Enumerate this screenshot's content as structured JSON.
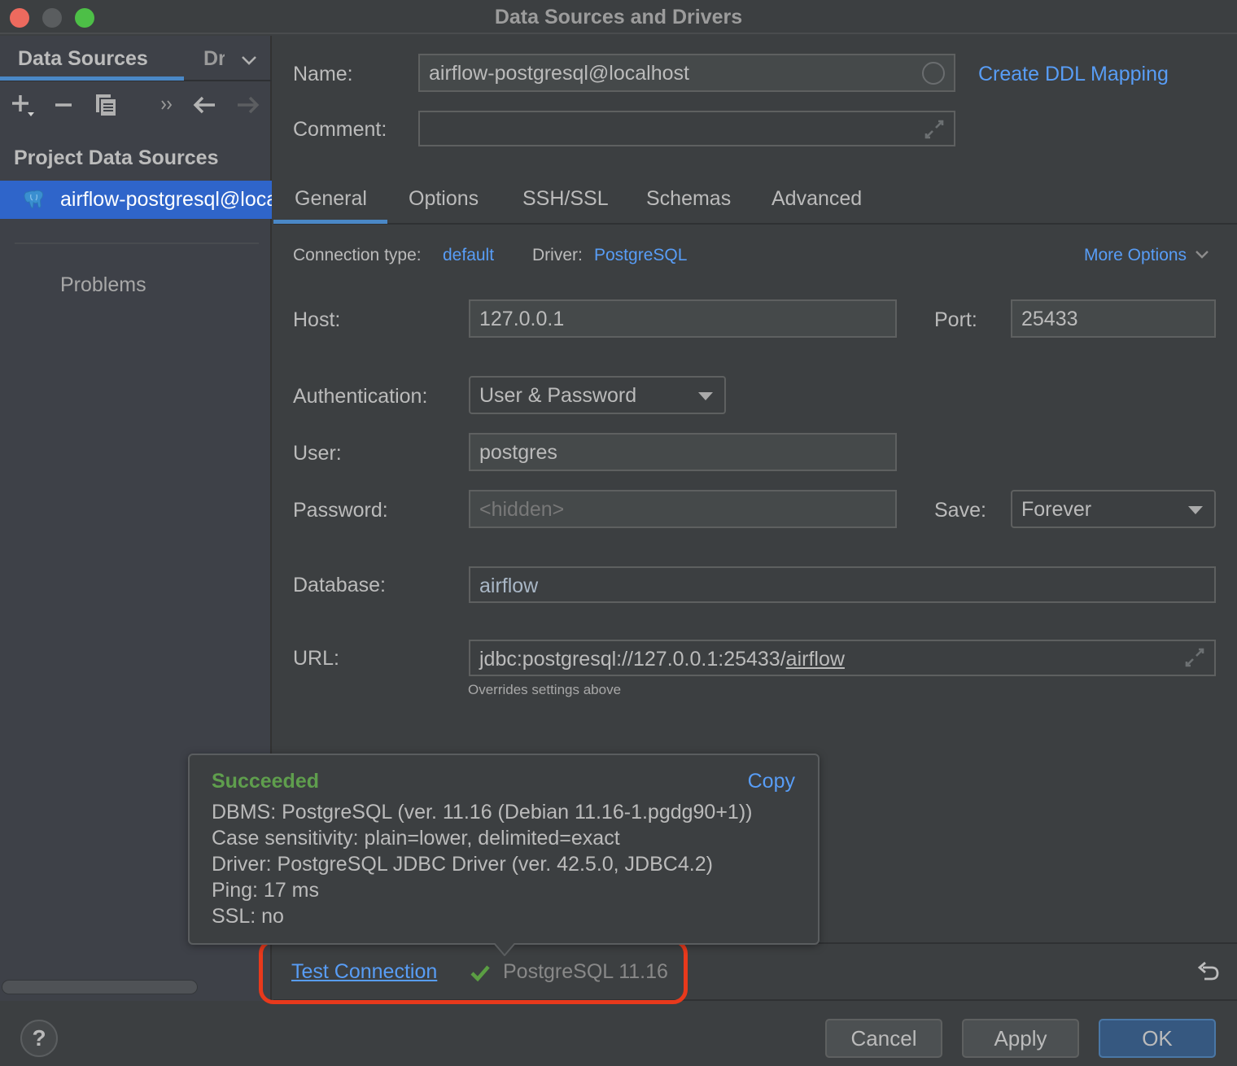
{
  "window": {
    "title": "Data Sources and Drivers"
  },
  "sidebar": {
    "tabs": [
      {
        "label": "Data Sources",
        "active": true
      },
      {
        "label": "Drivers",
        "active": false
      }
    ],
    "toolbar": {
      "add": "plus-icon",
      "remove": "minus-icon",
      "duplicate": "copy-icon",
      "more": "more-icon",
      "back": "arrow-left-icon",
      "forward": "arrow-right-icon"
    },
    "section_header": "Project Data Sources",
    "items": [
      {
        "label": "airflow-postgresql@localhost",
        "icon": "postgresql-elephant-icon",
        "selected": true
      }
    ],
    "problems_label": "Problems"
  },
  "form": {
    "name_label": "Name:",
    "name_value": "airflow-postgresql@localhost",
    "comment_label": "Comment:",
    "comment_value": "",
    "create_ddl_link": "Create DDL Mapping",
    "tabs": [
      {
        "label": "General",
        "active": true
      },
      {
        "label": "Options",
        "active": false
      },
      {
        "label": "SSH/SSL",
        "active": false
      },
      {
        "label": "Schemas",
        "active": false
      },
      {
        "label": "Advanced",
        "active": false
      }
    ],
    "connection_type_label": "Connection type:",
    "connection_type_value": "default",
    "driver_label": "Driver:",
    "driver_value": "PostgreSQL",
    "more_options": "More Options",
    "host_label": "Host:",
    "host_value": "127.0.0.1",
    "port_label": "Port:",
    "port_value": "25433",
    "auth_label": "Authentication:",
    "auth_value": "User & Password",
    "user_label": "User:",
    "user_value": "postgres",
    "password_label": "Password:",
    "password_placeholder": "<hidden>",
    "save_label": "Save:",
    "save_value": "Forever",
    "database_label": "Database:",
    "database_value": "airflow",
    "url_label": "URL:",
    "url_prefix": "jdbc:postgresql://127.0.0.1:25433/",
    "url_db": "airflow",
    "url_hint": "Overrides settings above"
  },
  "popup": {
    "status": "Succeeded",
    "copy_label": "Copy",
    "lines": [
      "DBMS: PostgreSQL (ver. 11.16 (Debian 11.16-1.pgdg90+1))",
      "Case sensitivity: plain=lower, delimited=exact",
      "Driver: PostgreSQL JDBC Driver (ver. 42.5.0, JDBC4.2)",
      "Ping: 17 ms",
      "SSL: no"
    ],
    "status_color": "#5f9e4d"
  },
  "test_connection": {
    "label": "Test Connection",
    "result_icon": "checkmark-icon",
    "result_text": "PostgreSQL 11.16",
    "highlight_color": "#e8391c"
  },
  "footer": {
    "help": "?",
    "cancel": "Cancel",
    "apply": "Apply",
    "ok": "OK"
  },
  "colors": {
    "accent": "#589df6",
    "selection": "#2f65ca",
    "primary_button": "#365880"
  }
}
